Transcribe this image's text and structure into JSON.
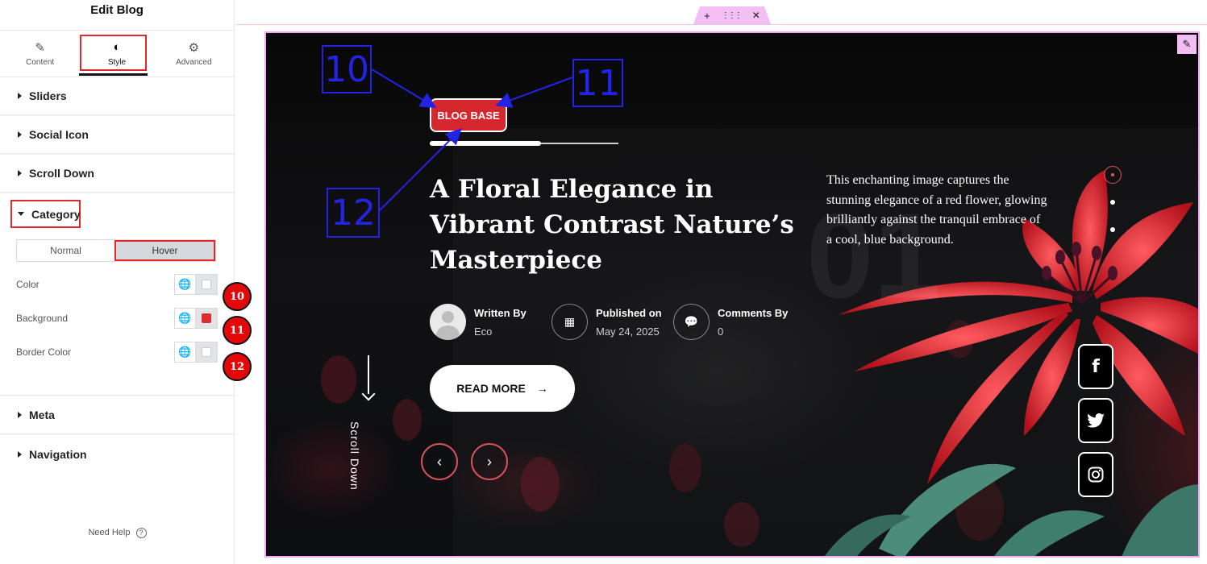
{
  "panel": {
    "title": "Edit Blog",
    "tabs": [
      {
        "label": "Content",
        "icon": "pencil-icon"
      },
      {
        "label": "Style",
        "icon": "half-circle-icon"
      },
      {
        "label": "Advanced",
        "icon": "gear-icon"
      }
    ],
    "active_tab": "Style",
    "sections_top": [
      "Sliders",
      "Social Icon",
      "Scroll Down"
    ],
    "category": {
      "label": "Category",
      "state_tabs": [
        "Normal",
        "Hover"
      ],
      "active_state": "Hover",
      "controls": [
        {
          "label": "Color",
          "swatch": "#ffffff",
          "badge": "10"
        },
        {
          "label": "Background",
          "swatch": "#dd2c33",
          "badge": "11"
        },
        {
          "label": "Border Color",
          "swatch": "#ffffff",
          "badge": "12"
        }
      ]
    },
    "sections_bottom": [
      "Meta",
      "Navigation"
    ],
    "help": "Need Help",
    "help_icon": "?"
  },
  "toolbar": {
    "add": "+",
    "drag": "⋮⋮⋮",
    "close": "✕"
  },
  "slide": {
    "category": "BLOG BASE",
    "progress": 0.59,
    "title": "A Floral Elegance in Vibrant Contrast Nature’s Masterpiece",
    "number": "01",
    "description": "This enchanting image captures the stunning elegance of a red flower, glowing brilliantly against the tranquil embrace of a cool, blue background.",
    "meta": {
      "author_key": "Written By",
      "author_val": "Eco",
      "date_key": "Published on",
      "date_val": "May 24, 2025",
      "comments_key": "Comments By",
      "comments_val": "0"
    },
    "read_more": "READ MORE",
    "read_more_arrow": "→",
    "prev": "‹",
    "next": "›",
    "scroll_down": "Scroll Down",
    "social": [
      {
        "icon": "facebook-icon",
        "glyph": "f"
      },
      {
        "icon": "twitter-icon",
        "glyph": "🐦"
      },
      {
        "icon": "instagram-icon",
        "glyph": "◎"
      }
    ]
  },
  "annotations": [
    "10",
    "11",
    "12"
  ],
  "colors": {
    "accent_red": "#d7272e",
    "annotation_blue": "#2323e6",
    "editor_pink": "#f3bef2"
  }
}
